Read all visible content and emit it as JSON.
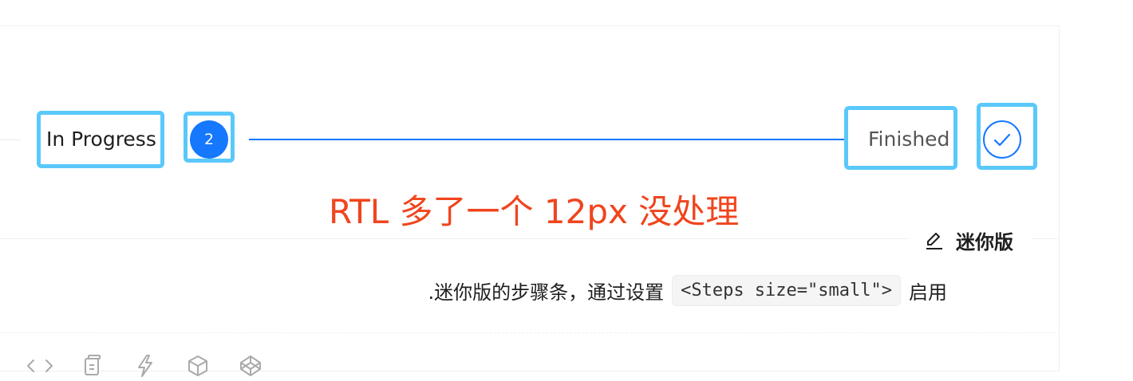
{
  "steps": {
    "items": [
      {
        "title": "In Progress",
        "number": "2",
        "status": "process"
      },
      {
        "title": "Finished",
        "status": "finish"
      }
    ],
    "accent": "#1677ff",
    "highlight": "#5ac8fa"
  },
  "annotation": {
    "text": "RTL 多了一个 12px 没处理",
    "color": "#f0451e"
  },
  "demo": {
    "meta_title": "迷你版",
    "edit_icon": "edit-icon",
    "description_prefix": ".迷你版的步骤条，通过设置",
    "description_code": "<Steps size=\"small\">",
    "description_suffix": "启用"
  },
  "actions": {
    "icons": [
      "code-icon",
      "copy-icon",
      "thunderbolt-icon",
      "codesandbox-icon",
      "codepen-icon"
    ]
  }
}
